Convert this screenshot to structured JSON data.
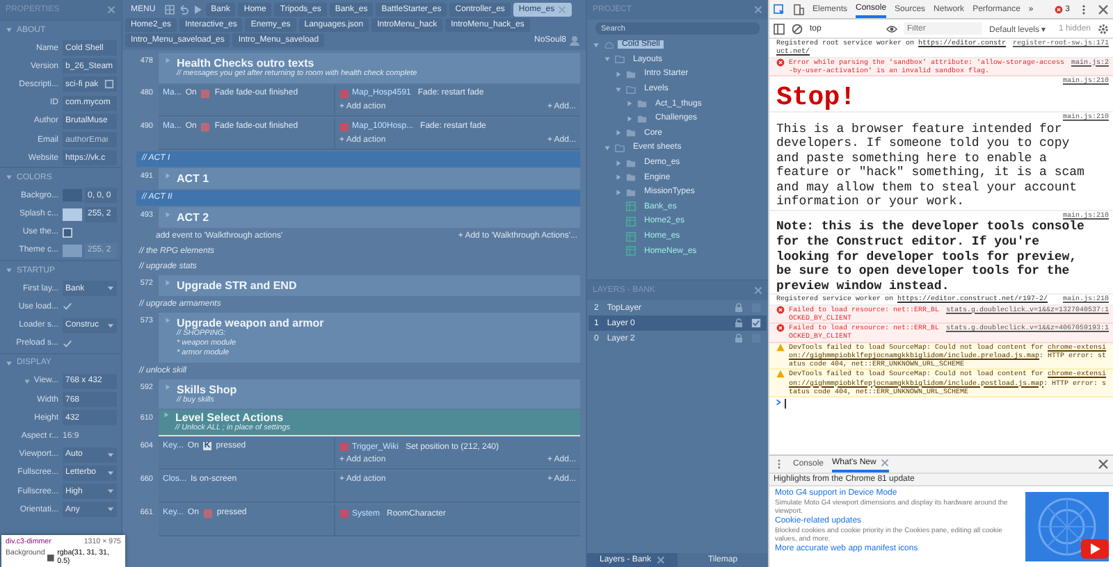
{
  "properties": {
    "title": "PROPERTIES",
    "sections": [
      {
        "name": "ABOUT",
        "expanded": true,
        "rows": [
          {
            "label": "Name",
            "kind": "text",
            "value": "Cold Shell"
          },
          {
            "label": "Version",
            "kind": "text",
            "value": "b_26_Steam"
          },
          {
            "label": "Descripti...",
            "kind": "text_button",
            "value": "sci-fi pak"
          },
          {
            "label": "ID",
            "kind": "text",
            "value": "com.mycom"
          },
          {
            "label": "Author",
            "kind": "text",
            "value": "BrutalMuse"
          },
          {
            "label": "Email",
            "kind": "text",
            "placeholder": "authorEmai"
          },
          {
            "label": "Website",
            "kind": "text",
            "value": "https://vk.c"
          }
        ]
      },
      {
        "name": "COLORS",
        "expanded": true,
        "rows": [
          {
            "label": "Backgro...",
            "kind": "color",
            "color": "#3f5f85",
            "value": "0, 0, 0",
            "disabled": false
          },
          {
            "label": "Splash c...",
            "kind": "color",
            "color": "#b3cbe6",
            "value": "255, 2",
            "disabled": false
          },
          {
            "label": "Use the...",
            "kind": "checkbox",
            "checked": false,
            "disabled": false
          },
          {
            "label": "Theme c...",
            "kind": "color",
            "color": "#7f9dc0",
            "value": "255, 2",
            "disabled": true
          }
        ]
      },
      {
        "name": "STARTUP",
        "expanded": true,
        "rows": [
          {
            "label": "First lay...",
            "kind": "select",
            "value": "Bank"
          },
          {
            "label": "Use load...",
            "kind": "checkbox",
            "checked": true
          },
          {
            "label": "Loader s...",
            "kind": "select",
            "value": "Construc"
          },
          {
            "label": "Preload s...",
            "kind": "checkbox",
            "checked": true
          }
        ]
      },
      {
        "name": "DISPLAY",
        "expanded": true,
        "rows": [
          {
            "label": "View...",
            "kind": "subgroup",
            "expanded": true,
            "value": "768 x 432",
            "children": [
              {
                "label": "Width",
                "kind": "text",
                "value": "768"
              },
              {
                "label": "Height",
                "kind": "text",
                "value": "432"
              }
            ]
          },
          {
            "label": "Aspect r...",
            "kind": "static",
            "value": "16:9"
          },
          {
            "label": "Viewport...",
            "kind": "select",
            "value": "Auto"
          },
          {
            "label": "Fullscree...",
            "kind": "select",
            "value": "Letterbo"
          },
          {
            "label": "Fullscree...",
            "kind": "select",
            "value": "High"
          },
          {
            "label": "Orientati...",
            "kind": "select",
            "value": "Any"
          }
        ]
      }
    ]
  },
  "editor": {
    "menu": "MENU",
    "user": "NoSoul8",
    "tabs": [
      {
        "label": "Bank",
        "selected": false
      },
      {
        "label": "Home",
        "selected": false
      },
      {
        "label": "Tripods_es",
        "selected": false
      },
      {
        "label": "Bank_es",
        "selected": false
      },
      {
        "label": "BattleStarter_es",
        "selected": false
      },
      {
        "label": "Controller_es",
        "selected": false
      },
      {
        "label": "Home_es",
        "selected": true
      },
      {
        "label": "Home2_es",
        "selected": false
      },
      {
        "label": "Interactive_es",
        "selected": false
      },
      {
        "label": "Enemy_es",
        "selected": false
      },
      {
        "label": "Languages.json",
        "selected": false
      },
      {
        "label": "IntroMenu_hack",
        "selected": false
      },
      {
        "label": "IntroMenu_hack_es",
        "selected": false
      },
      {
        "label": "Intro_Menu_saveload_es",
        "selected": false
      },
      {
        "label": "Intro_Menu_saveload",
        "selected": false
      }
    ],
    "events": [
      {
        "kind": "group",
        "line": "478",
        "title": "Health Checks outro texts",
        "comment": "// messages you get after returning to room with health check complete"
      },
      {
        "kind": "event",
        "line": "480",
        "object": "Ma...",
        "trigger": "On",
        "condition": "Fade fade-out finished",
        "action_object": "Map_Hosp4591",
        "action": "Fade: restart fade",
        "add_action": "+ Add action",
        "add_more": "+ Add..."
      },
      {
        "kind": "event",
        "line": "490",
        "object": "Ma...",
        "trigger": "On",
        "condition": "Fade fade-out finished",
        "action_object": "Map_100Hosp...",
        "action": "Fade: restart fade",
        "add_action": "+ Add action",
        "add_more": "+ Add..."
      },
      {
        "kind": "section",
        "title": "// ACT I"
      },
      {
        "kind": "group",
        "line": "491",
        "title": "ACT 1"
      },
      {
        "kind": "section",
        "title": "// ACT II"
      },
      {
        "kind": "group",
        "line": "493",
        "title": "ACT 2"
      },
      {
        "kind": "add",
        "title": "add event to 'Walkthrough actions'",
        "more": "+ Add to 'Walkthrough Actions'..."
      },
      {
        "kind": "comment",
        "title": "// the RPG elements"
      },
      {
        "kind": "comment",
        "title": "// upgrade stats"
      },
      {
        "kind": "group",
        "line": "572",
        "title": "Upgrade STR and END"
      },
      {
        "kind": "comment",
        "title": "// upgrade armaments"
      },
      {
        "kind": "group",
        "line": "573",
        "title": "Upgrade weapon and armor",
        "comment": "// SHOPPING:\n* weapon module\n* armor module"
      },
      {
        "kind": "comment",
        "title": "// unlock skill"
      },
      {
        "kind": "group",
        "line": "592",
        "title": "Skills Shop",
        "comment": "// buy skills"
      },
      {
        "kind": "highlight",
        "line": "610",
        "title": "Level Select Actions",
        "comment": "// Unlock ALL ; in place of settings"
      },
      {
        "kind": "event",
        "line": "604",
        "object": "Key...",
        "trigger": "On",
        "key": "K",
        "condition": "pressed",
        "action_object": "Trigger_Wiki",
        "action": "Set position to (212, 240)",
        "add_action": "+ Add action",
        "add_more": "+ Add..."
      },
      {
        "kind": "event",
        "line": "660",
        "object": "Clos...",
        "condition": "Is on-screen",
        "add_action": "+ Add action",
        "add_more": "+ Add..."
      },
      {
        "kind": "event",
        "line": "661",
        "object": "Key...",
        "trigger": "On",
        "condition": "pressed",
        "action_object": "System",
        "action": "RoomCharacter"
      }
    ]
  },
  "project": {
    "title": "PROJECT",
    "search_placeholder": "Search",
    "tree": [
      {
        "label": "Cold Shell",
        "kind": "root",
        "selected": true,
        "expanded": true,
        "children": [
          {
            "label": "Layouts",
            "kind": "folder",
            "selected": false,
            "expanded": true,
            "children": [
              {
                "label": "Intro Starter",
                "kind": "folder",
                "selected": false,
                "expanded": false
              },
              {
                "label": "Levels",
                "kind": "folder",
                "selected": false,
                "expanded": true,
                "children": [
                  {
                    "label": "Act_1_thugs",
                    "kind": "folder",
                    "selected": false,
                    "expanded": false
                  },
                  {
                    "label": "Challenges",
                    "kind": "folder",
                    "selected": false,
                    "expanded": false
                  }
                ]
              },
              {
                "label": "Core",
                "kind": "folder",
                "selected": false,
                "expanded": false
              }
            ]
          },
          {
            "label": "Event sheets",
            "kind": "folder",
            "selected": false,
            "expanded": true,
            "children": [
              {
                "label": "Demo_es",
                "kind": "folder",
                "selected": false,
                "expanded": false
              },
              {
                "label": "Engine",
                "kind": "folder",
                "selected": false,
                "expanded": false
              },
              {
                "label": "MissionTypes",
                "kind": "folder",
                "selected": false,
                "expanded": false
              },
              {
                "label": "Bank_es",
                "kind": "sheet",
                "selected": false
              },
              {
                "label": "Home2_es",
                "kind": "sheet",
                "selected": false
              },
              {
                "label": "Home_es",
                "kind": "sheet",
                "selected": false
              },
              {
                "label": "HomeNew_es",
                "kind": "sheet",
                "selected": false
              }
            ]
          }
        ]
      }
    ]
  },
  "layers": {
    "title": "LAYERS - BANK",
    "rows": [
      {
        "index": "2",
        "name": "TopLayer",
        "locked": true,
        "visible": false,
        "selected": false
      },
      {
        "index": "1",
        "name": "Layer 0",
        "locked": false,
        "visible": true,
        "selected": true
      },
      {
        "index": "0",
        "name": "Layer 2",
        "locked": true,
        "visible": false,
        "selected": false
      }
    ],
    "tabs": [
      {
        "label": "Layers - Bank",
        "selected": true
      },
      {
        "label": "Tilemap",
        "selected": false
      }
    ]
  },
  "inspect_tooltip": {
    "selector": "div.c3-dimmer",
    "size": "1310 × 975",
    "property": "Background",
    "value": "rgba(31, 31, 31, 0.5)"
  },
  "devtools": {
    "tabs": [
      {
        "label": "Elements",
        "selected": false
      },
      {
        "label": "Console",
        "selected": true
      },
      {
        "label": "Sources",
        "selected": false
      },
      {
        "label": "Network",
        "selected": false
      },
      {
        "label": "Performance",
        "selected": false
      }
    ],
    "more": "»",
    "error_count": "3",
    "context": "top",
    "filter_placeholder": "Filter",
    "levels": "Default levels ▾",
    "hidden": "1 hidden",
    "messages": [
      {
        "kind": "info",
        "text": "Registered root service worker on ",
        "link": "https://editor.construct.net/",
        "source": "register-root-sw.js:171"
      },
      {
        "kind": "error",
        "text": "Error while parsing the 'sandbox' attribute: 'allow-storage-access-by-user-activation' is an invalid sandbox flag.",
        "source": "main.js:2"
      },
      {
        "kind": "banner",
        "text": "Stop!",
        "source": "main.js:210"
      },
      {
        "kind": "large",
        "text": "This is a browser feature intended for developers. If someone told you to copy and paste something here to enable a feature or \"hack\" something, it is a scam and may allow them to steal your account information or your work.",
        "source": "main.js:210"
      },
      {
        "kind": "large_bold",
        "text": "Note: this is the developer tools console for the Construct editor. If you're looking for developer tools for preview, be sure to open developer tools for the preview window instead.",
        "source": "main.js:210"
      },
      {
        "kind": "info",
        "text": "Registered service worker on ",
        "link": "https://editor.construct.net/r197-2/",
        "source": "main.js:210"
      },
      {
        "kind": "error",
        "text": "Failed to load resource: net::ERR_BLOCKED_BY_CLIENT",
        "source": "stats.g.doubleclick…v=1&&z=1327040537:1"
      },
      {
        "kind": "error",
        "text": "Failed to load resource: net::ERR_BLOCKED_BY_CLIENT",
        "source": "stats.g.doubleclick…v=1&&z=4067059193:1"
      },
      {
        "kind": "warning",
        "text": "DevTools failed to load SourceMap: Could not load content for ",
        "link": "chrome-extension://gighmmpiobklfepjocnamgkkbiglidom/include.preload.js.map",
        "after": ": HTTP error: status code 404, net::ERR_UNKNOWN_URL_SCHEME"
      },
      {
        "kind": "warning",
        "text": "DevTools failed to load SourceMap: Could not load content for ",
        "link": "chrome-extension://gighmmpiobklfepjocnamgkkbiglidom/include.postload.js.map",
        "after": ": HTTP error: status code 404, net::ERR_UNKNOWN_URL_SCHEME"
      }
    ],
    "drawer": {
      "tabs": [
        {
          "label": "Console",
          "selected": false
        },
        {
          "label": "What's New",
          "selected": true
        }
      ],
      "headline": "Highlights from the Chrome 81 update",
      "items": [
        {
          "title": "Moto G4 support in Device Mode",
          "text": "Simulate Moto G4 viewport dimensions and display its hardware around the viewport."
        },
        {
          "title": "Cookie-related updates",
          "text": "Blocked cookies and cookie priority in the Cookies pane, editing all cookie values, and more."
        },
        {
          "title": "More accurate web app manifest icons"
        }
      ]
    }
  }
}
